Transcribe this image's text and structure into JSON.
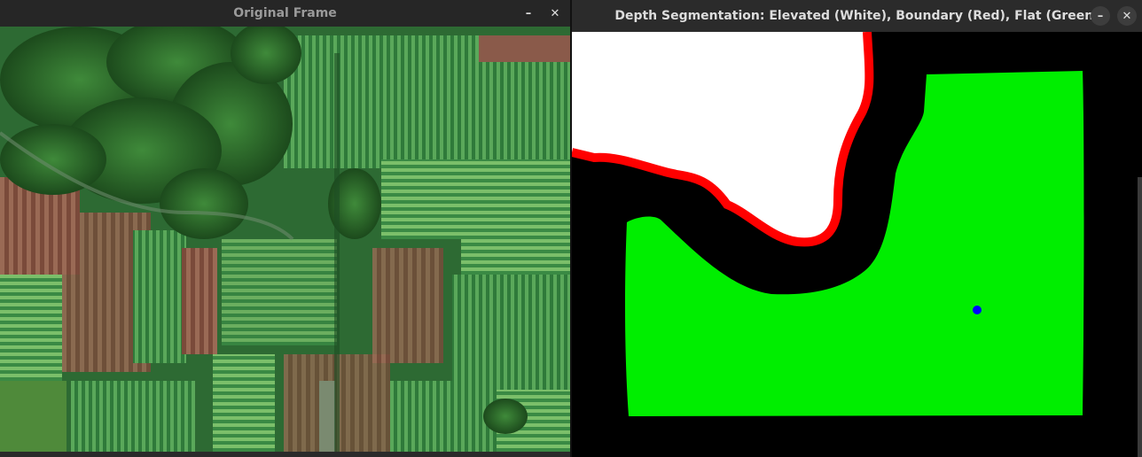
{
  "windows": {
    "original": {
      "title": "Original Frame",
      "minimize_icon": "minimize-icon",
      "close_icon": "close-icon"
    },
    "segmentation": {
      "title": "Depth Segmentation: Elevated (White), Boundary (Red), Flat (Green)",
      "minimize_icon": "minimize-icon",
      "close_icon": "close-icon"
    }
  },
  "colors": {
    "elevated": "#ffffff",
    "boundary": "#ff0000",
    "flat": "#00ee00",
    "marker": "#0000ff",
    "background": "#000000"
  }
}
